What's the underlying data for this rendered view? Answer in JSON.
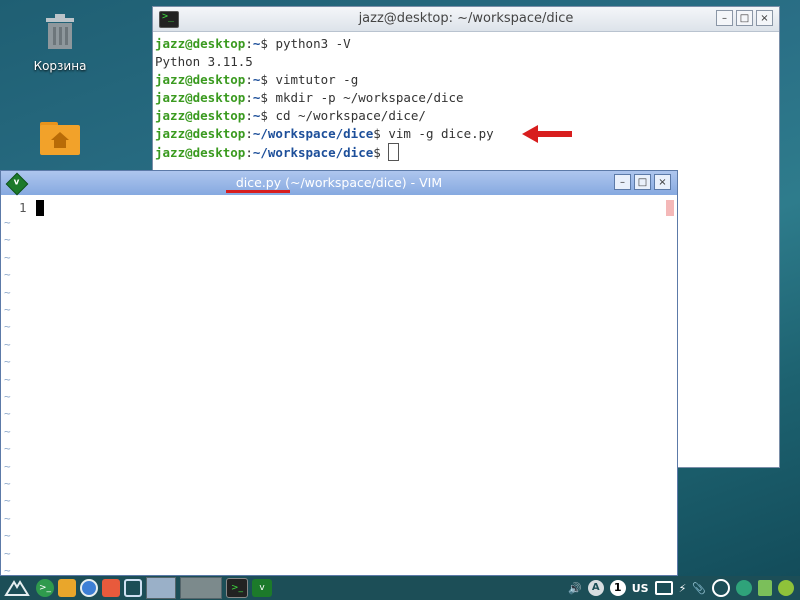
{
  "desktop": {
    "trash_label": "Корзина",
    "home_label": ""
  },
  "terminal": {
    "title": "jazz@desktop: ~/workspace/dice",
    "lines": [
      {
        "user": "jazz@desktop",
        "sep": ":",
        "path": "~",
        "dollar": "$ ",
        "cmd": "python3 -V"
      },
      {
        "output": "Python 3.11.5"
      },
      {
        "user": "jazz@desktop",
        "sep": ":",
        "path": "~",
        "dollar": "$ ",
        "cmd": "vimtutor -g"
      },
      {
        "user": "jazz@desktop",
        "sep": ":",
        "path": "~",
        "dollar": "$ ",
        "cmd": "mkdir -p ~/workspace/dice"
      },
      {
        "user": "jazz@desktop",
        "sep": ":",
        "path": "~",
        "dollar": "$ ",
        "cmd": "cd ~/workspace/dice/"
      },
      {
        "user": "jazz@desktop",
        "sep": ":",
        "path": "~/workspace/dice",
        "dollar": "$ ",
        "cmd": "vim -g dice.py"
      },
      {
        "user": "jazz@desktop",
        "sep": ":",
        "path": "~/workspace/dice",
        "dollar": "$ ",
        "cmd": ""
      }
    ]
  },
  "vim": {
    "title": "dice.py (~/workspace/dice) - VIM",
    "line_number": "1",
    "tilde": "~"
  },
  "window_buttons": {
    "minimize": "–",
    "maximize": "□",
    "close": "×"
  },
  "taskbar": {
    "keyboard_layout": "US",
    "workspace_number": "1"
  },
  "colors": {
    "accent_red": "#d81e1e",
    "prompt_green": "#3a9a1f",
    "prompt_blue": "#1d4f9a"
  }
}
